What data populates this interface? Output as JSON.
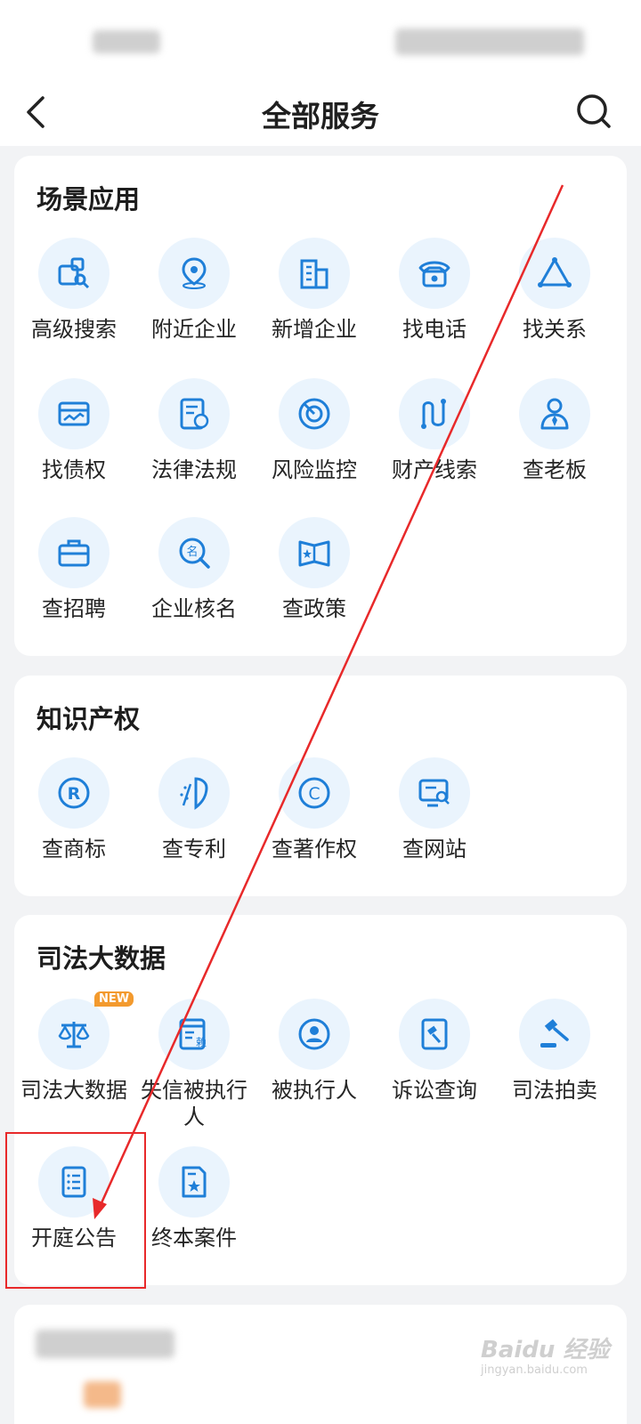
{
  "header": {
    "title": "全部服务"
  },
  "sections": [
    {
      "title": "场景应用",
      "items": [
        {
          "label": "高级搜索",
          "icon": "advanced-search-icon"
        },
        {
          "label": "附近企业",
          "icon": "location-pin-icon"
        },
        {
          "label": "新增企业",
          "icon": "building-icon"
        },
        {
          "label": "找电话",
          "icon": "telephone-icon"
        },
        {
          "label": "找关系",
          "icon": "relation-triangle-icon"
        },
        {
          "label": "找债权",
          "icon": "credit-card-icon"
        },
        {
          "label": "法律法规",
          "icon": "law-document-icon"
        },
        {
          "label": "风险监控",
          "icon": "radar-icon"
        },
        {
          "label": "财产线索",
          "icon": "clue-path-icon"
        },
        {
          "label": "查老板",
          "icon": "boss-icon"
        },
        {
          "label": "查招聘",
          "icon": "briefcase-icon"
        },
        {
          "label": "企业核名",
          "icon": "name-check-icon"
        },
        {
          "label": "查政策",
          "icon": "policy-book-icon"
        }
      ]
    },
    {
      "title": "知识产权",
      "items": [
        {
          "label": "查商标",
          "icon": "trademark-icon"
        },
        {
          "label": "查专利",
          "icon": "patent-icon"
        },
        {
          "label": "查著作权",
          "icon": "copyright-icon"
        },
        {
          "label": "查网站",
          "icon": "website-search-icon"
        }
      ]
    },
    {
      "title": "司法大数据",
      "items": [
        {
          "label": "司法大数据",
          "icon": "scales-icon",
          "badge": "NEW"
        },
        {
          "label": "失信被执行人",
          "icon": "dishonest-doc-icon"
        },
        {
          "label": "被执行人",
          "icon": "person-circle-icon"
        },
        {
          "label": "诉讼查询",
          "icon": "lawsuit-doc-icon"
        },
        {
          "label": "司法拍卖",
          "icon": "auction-gavel-icon"
        },
        {
          "label": "开庭公告",
          "icon": "notice-list-icon"
        },
        {
          "label": "终本案件",
          "icon": "case-file-icon"
        }
      ]
    }
  ],
  "watermark": {
    "text": "Baidu 经验",
    "sub": "jingyan.baidu.com"
  },
  "colors": {
    "accent": "#1f7fd8",
    "icon_bg": "#eaf4fd",
    "annotation": "#e8292a",
    "badge": "#f39a2e"
  }
}
